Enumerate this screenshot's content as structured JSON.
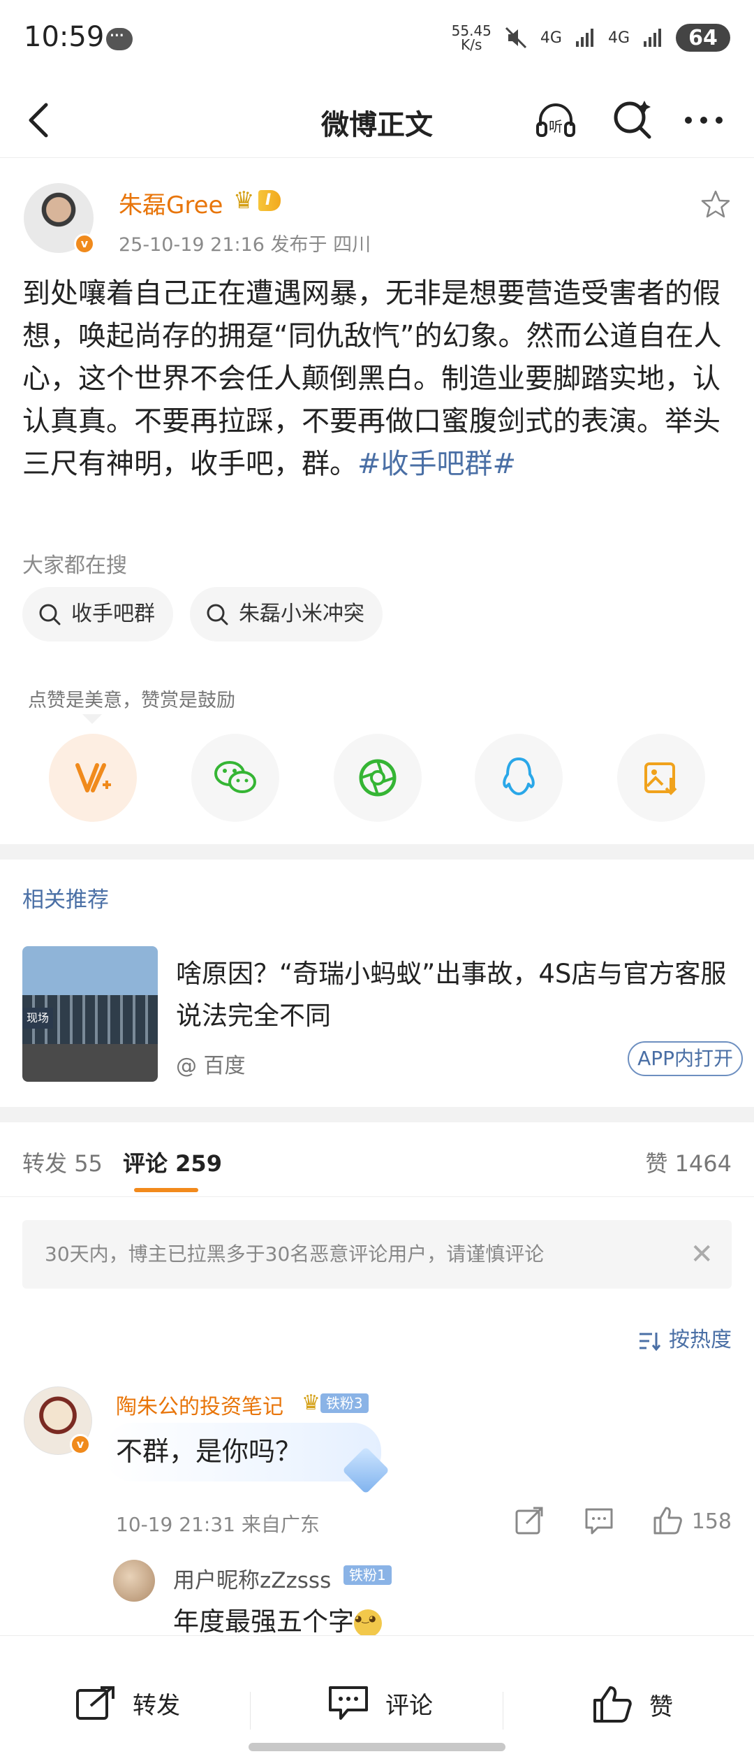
{
  "status_bar": {
    "time": "10:59",
    "net_speed_value": "55.45",
    "net_speed_unit": "K/s",
    "signal1": "4G",
    "signal2": "4G",
    "battery": "64"
  },
  "nav": {
    "title": "微博正文"
  },
  "post": {
    "author": "朱磊Gree",
    "level_badge": "I",
    "meta": "25-10-19 21:16   发布于 四川",
    "content_before": "到处嚷着自己正在遭遇网暴，无非是想要营造受害者的假想，唤起尚存的拥趸“同仇敌忾”的幻象。然而公道自在人心，这个世界不会任人颠倒黑白。制造业要脚踏实地，认认真真。不要再拉踩，不要再做口蜜腹剑式的表演。举头三尺有神明，收手吧，群。",
    "content_tag": "#收手吧群#"
  },
  "search": {
    "title": "大家都在搜",
    "chips": [
      "收手吧群",
      "朱磊小米冲突"
    ]
  },
  "tip": "点赞是美意，赞赏是鼓励",
  "share": {
    "icons": [
      "reward-icon",
      "wechat-icon",
      "moments-icon",
      "qq-icon",
      "save-image-icon"
    ],
    "accent": "#f08a1c"
  },
  "related": {
    "title": "相关推荐",
    "headline": "啥原因？“奇瑞小蚂蚁”出事故，4S店与官方客服说法完全不同",
    "source": "@ 百度",
    "app_open": "APP内打开"
  },
  "tabs": {
    "repost_label": "转发",
    "repost_count": "55",
    "comment_label": "评论",
    "comment_count": "259",
    "like_label": "赞",
    "like_count": "1464"
  },
  "notice": "30天内，博主已拉黑多于30名恶意评论用户，请谨慎评论",
  "sort_label": "按热度",
  "comment": {
    "name": "陶朱公的投资笔记",
    "fan_badge": "铁粉3",
    "text": "不群，是你吗？",
    "meta": "10-19 21:31   来自广东",
    "likes": "158",
    "reply": {
      "name": "用户昵称zZzsss",
      "fan_badge": "铁粉1",
      "text": "年度最强五个字"
    }
  },
  "bottom_bar": {
    "repost": "转发",
    "comment": "评论",
    "like": "赞"
  }
}
